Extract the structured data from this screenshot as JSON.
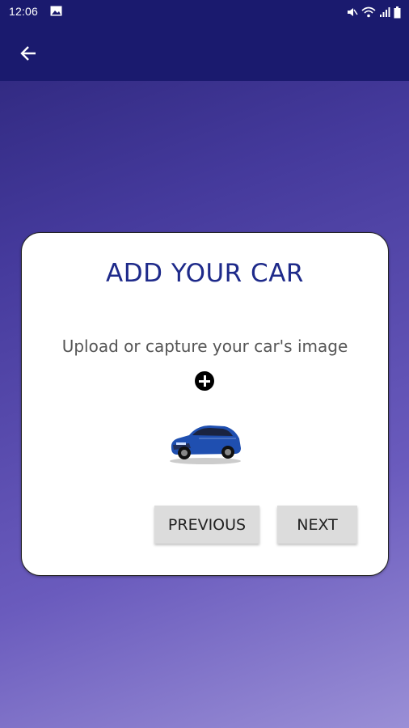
{
  "status_bar": {
    "time": "12:06",
    "icons": [
      "image-icon",
      "mute-icon",
      "wifi-icon",
      "signal-icon",
      "battery-icon"
    ]
  },
  "app_bar": {
    "back_icon": "arrow-left-icon"
  },
  "card": {
    "title": "ADD YOUR CAR",
    "subtitle": "Upload or capture your car's image",
    "add_icon": "plus-circle-icon",
    "car_image": "car-photo",
    "previous_label": "PREVIOUS",
    "next_label": "NEXT"
  },
  "colors": {
    "app_bar": "#1a1a6e",
    "title": "#1e2a8a",
    "button_bg": "#dcdcdc",
    "car_body": "#1f4fb0"
  }
}
